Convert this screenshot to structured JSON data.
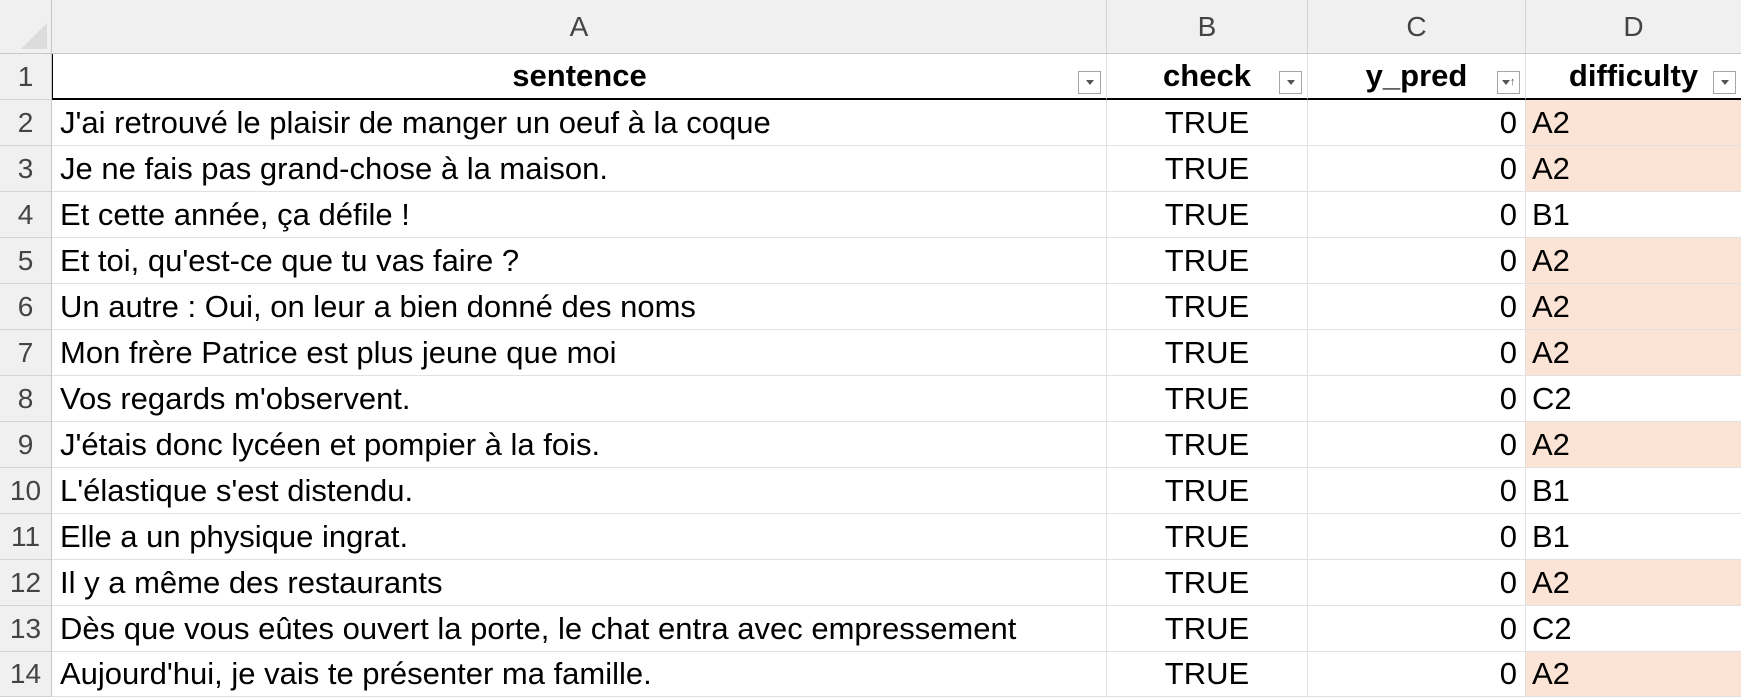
{
  "columns": {
    "A": "A",
    "B": "B",
    "C": "C",
    "D": "D"
  },
  "header": {
    "row": "1",
    "sentence": "sentence",
    "check": "check",
    "y_pred": "y_pred",
    "difficulty": "difficulty"
  },
  "colors": {
    "difficulty_highlight": "#fbe4d5",
    "header_bg": "#f0f0f0"
  },
  "rows": [
    {
      "num": "2",
      "sentence": "J'ai retrouvé le plaisir de manger un oeuf à la coque",
      "check": "TRUE",
      "y_pred": "0",
      "difficulty": "A2"
    },
    {
      "num": "3",
      "sentence": "Je ne fais pas grand-chose à la maison.",
      "check": "TRUE",
      "y_pred": "0",
      "difficulty": "A2"
    },
    {
      "num": "4",
      "sentence": "Et cette année, ça défile !",
      "check": "TRUE",
      "y_pred": "0",
      "difficulty": "B1"
    },
    {
      "num": "5",
      "sentence": "Et toi, qu'est-ce que tu vas faire ?",
      "check": "TRUE",
      "y_pred": "0",
      "difficulty": "A2"
    },
    {
      "num": "6",
      "sentence": "Un autre : Oui, on leur a bien donné des noms",
      "check": "TRUE",
      "y_pred": "0",
      "difficulty": "A2"
    },
    {
      "num": "7",
      "sentence": "Mon frère Patrice est plus jeune que moi",
      "check": "TRUE",
      "y_pred": "0",
      "difficulty": "A2"
    },
    {
      "num": "8",
      "sentence": "Vos regards m'observent.",
      "check": "TRUE",
      "y_pred": "0",
      "difficulty": "C2"
    },
    {
      "num": "9",
      "sentence": "J'étais donc lycéen et pompier à la fois.",
      "check": "TRUE",
      "y_pred": "0",
      "difficulty": "A2"
    },
    {
      "num": "10",
      "sentence": "L'élastique s'est distendu.",
      "check": "TRUE",
      "y_pred": "0",
      "difficulty": "B1"
    },
    {
      "num": "11",
      "sentence": "Elle a un physique ingrat.",
      "check": "TRUE",
      "y_pred": "0",
      "difficulty": "B1"
    },
    {
      "num": "12",
      "sentence": "Il y a même des restaurants",
      "check": "TRUE",
      "y_pred": "0",
      "difficulty": "A2"
    },
    {
      "num": "13",
      "sentence": "Dès que vous eûtes ouvert la porte, le chat entra avec empressement",
      "check": "TRUE",
      "y_pred": "0",
      "difficulty": "C2"
    },
    {
      "num": "14",
      "sentence": "Aujourd'hui, je vais te présenter ma famille.",
      "check": "TRUE",
      "y_pred": "0",
      "difficulty": "A2"
    }
  ]
}
